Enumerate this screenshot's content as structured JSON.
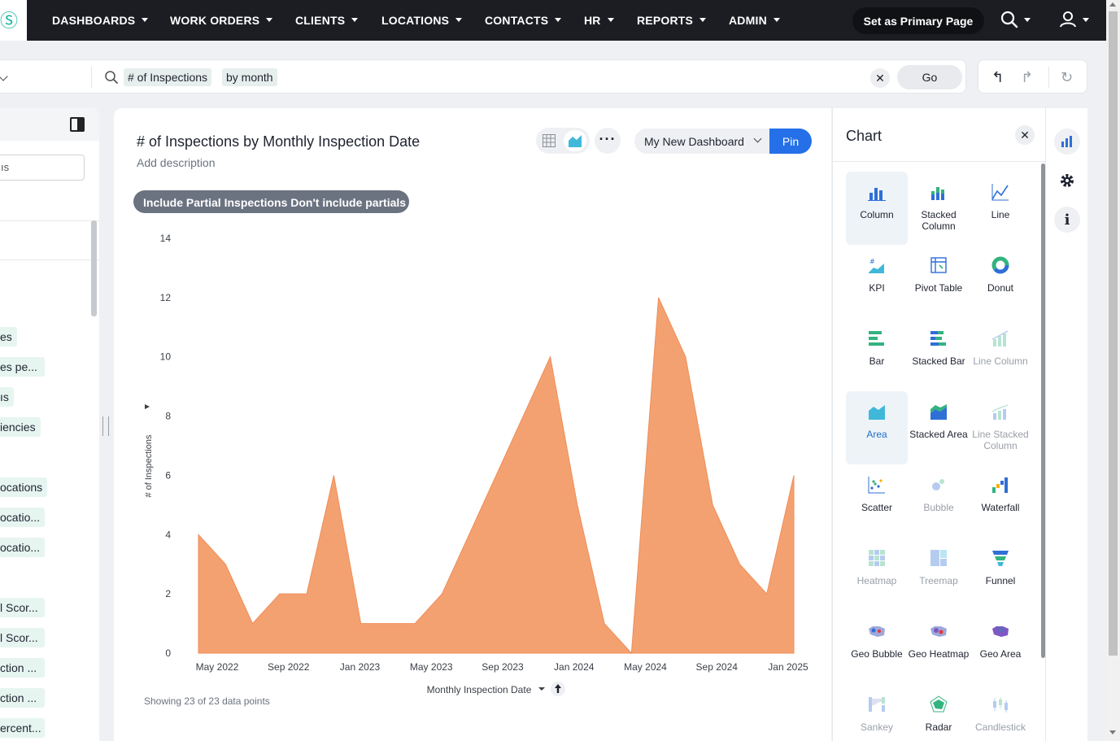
{
  "nav": {
    "logo_glyph": "Ⓢ",
    "items": [
      {
        "label": "DASHBOARDS"
      },
      {
        "label": "WORK ORDERS"
      },
      {
        "label": "CLIENTS"
      },
      {
        "label": "LOCATIONS"
      },
      {
        "label": "CONTACTS"
      },
      {
        "label": "HR"
      },
      {
        "label": "REPORTS"
      },
      {
        "label": "ADMIN"
      }
    ],
    "primary_page_label": "Set as Primary Page"
  },
  "search": {
    "tokens": [
      "# of Inspections",
      "by month"
    ],
    "go_label": "Go",
    "clear_glyph": "✕"
  },
  "history": {
    "undo_glyph": "↰",
    "redo_glyph": "↱",
    "reset_glyph": "↻"
  },
  "left_panel": {
    "search_fragment": "ıs",
    "items": [
      {
        "label": "es",
        "tag": true
      },
      {
        "label": "es pe...",
        "tag": true
      },
      {
        "label": "ıs",
        "tag": true
      },
      {
        "label": "iencies",
        "tag": true
      },
      {
        "label": "ocations",
        "tag": true
      },
      {
        "label": "ocatio...",
        "tag": true
      },
      {
        "label": "ocatio...",
        "tag": true
      },
      {
        "label": "l Scor...",
        "tag": true
      },
      {
        "label": "l Scor...",
        "tag": true
      },
      {
        "label": "ction ...",
        "tag": true
      },
      {
        "label": "ction ...",
        "tag": true
      },
      {
        "label": "ercent...",
        "tag": true
      }
    ]
  },
  "card": {
    "title": "# of Inspections by Monthly Inspection Date",
    "description": "Add description",
    "dashboard_select": "My New Dashboard",
    "pin_label": "Pin",
    "more_label": "···",
    "filter_chip": "Include Partial Inspections Don't include partials",
    "footer": "Showing 23 of 23 data points"
  },
  "chart_data": {
    "type": "area",
    "title": "# of Inspections by Monthly Inspection Date",
    "xlabel": "Monthly Inspection Date",
    "ylabel": "# of Inspections",
    "ylim": [
      0,
      14
    ],
    "yticks": [
      0,
      2,
      4,
      6,
      8,
      10,
      12,
      14
    ],
    "xticks": [
      "May 2022",
      "Sep 2022",
      "Jan 2023",
      "May 2023",
      "Sep 2023",
      "Jan 2024",
      "May 2024",
      "Sep 2024",
      "Jan 2025"
    ],
    "x": [
      "2022-05",
      "2022-07",
      "2022-09",
      "2022-11",
      "2023-01",
      "2023-03",
      "2023-04",
      "2023-05",
      "2023-06",
      "2023-07",
      "2023-08",
      "2023-09",
      "2023-10",
      "2024-01",
      "2024-02",
      "2024-03",
      "2024-04",
      "2024-05",
      "2024-06",
      "2024-07",
      "2024-08",
      "2024-09",
      "2024-10",
      "2024-11",
      "2024-12",
      "2025-01"
    ],
    "values": [
      4,
      3,
      1,
      2,
      2,
      6,
      1,
      1,
      1,
      2,
      4,
      6,
      8,
      10,
      5,
      1,
      0,
      12,
      10,
      5,
      3,
      2,
      6
    ],
    "series": [
      {
        "values": [
          4,
          3,
          1,
          2,
          2,
          6,
          1,
          1,
          1,
          2,
          4,
          6,
          8,
          10,
          5,
          1,
          0,
          12,
          10,
          5,
          3,
          2,
          6
        ]
      }
    ],
    "colors": {
      "fill": "#f4a171",
      "stroke": "#ef8d57"
    },
    "grid": false,
    "legend": "none"
  },
  "chart_types": {
    "header": "Chart",
    "close_glyph": "✕",
    "tiles": [
      {
        "label": "Column",
        "icon": "column-chart-icon",
        "state": "selected-hint"
      },
      {
        "label": "Stacked Column",
        "icon": "stacked-column-chart-icon",
        "state": "enabled"
      },
      {
        "label": "Line",
        "icon": "line-chart-icon",
        "state": "enabled"
      },
      {
        "label": "KPI",
        "icon": "kpi-chart-icon",
        "state": "enabled"
      },
      {
        "label": "Pivot Table",
        "icon": "pivot-table-icon",
        "state": "enabled"
      },
      {
        "label": "Donut",
        "icon": "donut-chart-icon",
        "state": "enabled"
      },
      {
        "label": "Bar",
        "icon": "bar-chart-icon",
        "state": "enabled"
      },
      {
        "label": "Stacked Bar",
        "icon": "stacked-bar-chart-icon",
        "state": "enabled"
      },
      {
        "label": "Line Column",
        "icon": "line-column-chart-icon",
        "state": "disabled"
      },
      {
        "label": "Area",
        "icon": "area-chart-icon",
        "state": "selected"
      },
      {
        "label": "Stacked Area",
        "icon": "stacked-area-chart-icon",
        "state": "enabled"
      },
      {
        "label": "Line Stacked Column",
        "icon": "line-stacked-column-chart-icon",
        "state": "disabled"
      },
      {
        "label": "Scatter",
        "icon": "scatter-chart-icon",
        "state": "enabled"
      },
      {
        "label": "Bubble",
        "icon": "bubble-chart-icon",
        "state": "disabled"
      },
      {
        "label": "Waterfall",
        "icon": "waterfall-chart-icon",
        "state": "enabled"
      },
      {
        "label": "Heatmap",
        "icon": "heatmap-chart-icon",
        "state": "disabled"
      },
      {
        "label": "Treemap",
        "icon": "treemap-chart-icon",
        "state": "disabled"
      },
      {
        "label": "Funnel",
        "icon": "funnel-chart-icon",
        "state": "enabled"
      },
      {
        "label": "Geo Bubble",
        "icon": "geo-bubble-chart-icon",
        "state": "enabled"
      },
      {
        "label": "Geo Heatmap",
        "icon": "geo-heatmap-chart-icon",
        "state": "enabled"
      },
      {
        "label": "Geo Area",
        "icon": "geo-area-chart-icon",
        "state": "enabled"
      },
      {
        "label": "Sankey",
        "icon": "sankey-chart-icon",
        "state": "disabled"
      },
      {
        "label": "Radar",
        "icon": "radar-chart-icon",
        "state": "enabled"
      },
      {
        "label": "Candlestick",
        "icon": "candlestick-chart-icon",
        "state": "disabled"
      }
    ]
  },
  "rail": {
    "buttons": [
      {
        "icon": "chart-settings-icon"
      },
      {
        "icon": "gear-icon"
      },
      {
        "icon": "info-icon",
        "glyph": "i"
      }
    ]
  },
  "theme": {
    "accent": "#2570e8",
    "nav_bg": "#1b1d22",
    "area_fill": "#f4a171",
    "token_bg": "#e6efed"
  }
}
